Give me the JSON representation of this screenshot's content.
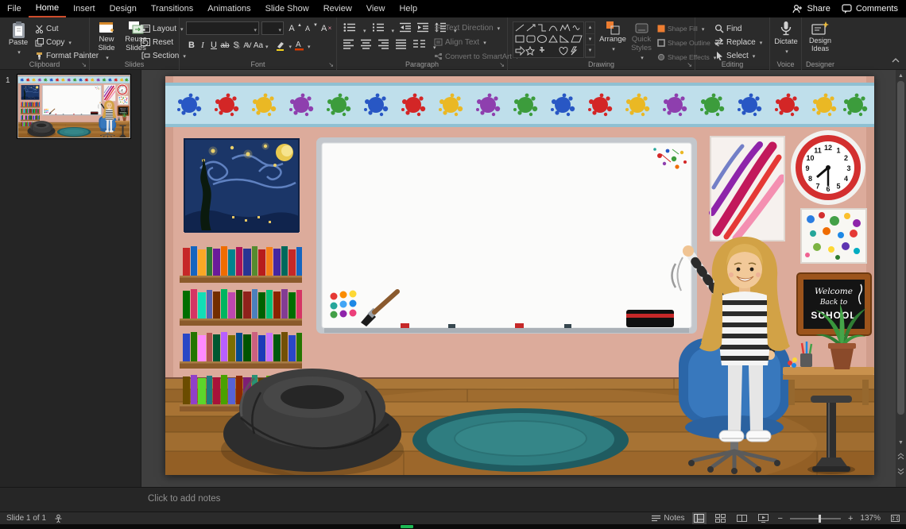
{
  "colors": {
    "accent": "#cf4d2c",
    "shape_fill_swatch": "#ed7d31",
    "wall": "#dcab9b",
    "rug_teal": "#2f7d80",
    "statusbar_green": "#1db954"
  },
  "menubar": {
    "items": [
      "File",
      "Home",
      "Insert",
      "Design",
      "Transitions",
      "Animations",
      "Slide Show",
      "Review",
      "View",
      "Help"
    ],
    "active_tab": "Home",
    "share": "Share",
    "comments": "Comments"
  },
  "ribbon": {
    "clipboard": {
      "group_label": "Clipboard",
      "paste": "Paste",
      "cut": "Cut",
      "copy": "Copy",
      "format_painter": "Format Painter"
    },
    "slides": {
      "group_label": "Slides",
      "new_slide": "New Slide",
      "reuse_slides": "Reuse Slides",
      "layout": "Layout",
      "reset": "Reset",
      "section": "Section"
    },
    "font": {
      "group_label": "Font",
      "bold": "B",
      "italic": "I",
      "underline": "U",
      "strike": "ab",
      "shadow": "S",
      "spacing": "AV",
      "case": "Aa",
      "grow": "A",
      "shrink": "A",
      "clear": "A",
      "color": "A"
    },
    "paragraph": {
      "group_label": "Paragraph",
      "text_direction": "Text Direction",
      "align_text": "Align Text",
      "smartart": "Convert to SmartArt"
    },
    "drawing": {
      "group_label": "Drawing",
      "arrange": "Arrange",
      "quick_styles": "Quick Styles",
      "shape_fill": "Shape Fill",
      "shape_outline": "Shape Outline",
      "shape_effects": "Shape Effects"
    },
    "editing": {
      "group_label": "Editing",
      "find": "Find",
      "replace": "Replace",
      "select": "Select"
    },
    "voice": {
      "group_label": "Voice",
      "dictate": "Dictate"
    },
    "designer": {
      "group_label": "Designer",
      "design_ideas": "Design Ideas"
    }
  },
  "thumbnail_panel": {
    "slide_number": "1"
  },
  "slide": {
    "sign": {
      "line1": "Welcome",
      "line2": "Back to",
      "line3": "SCHOOL"
    },
    "clock_numbers": [
      "12",
      "1",
      "2",
      "3",
      "4",
      "5",
      "6",
      "7",
      "8",
      "9",
      "10",
      "11"
    ]
  },
  "notes": {
    "placeholder": "Click to add notes"
  },
  "statusbar": {
    "slide_indicator": "Slide 1 of 1",
    "notes_toggle": "Notes",
    "zoom_level": "137%"
  }
}
